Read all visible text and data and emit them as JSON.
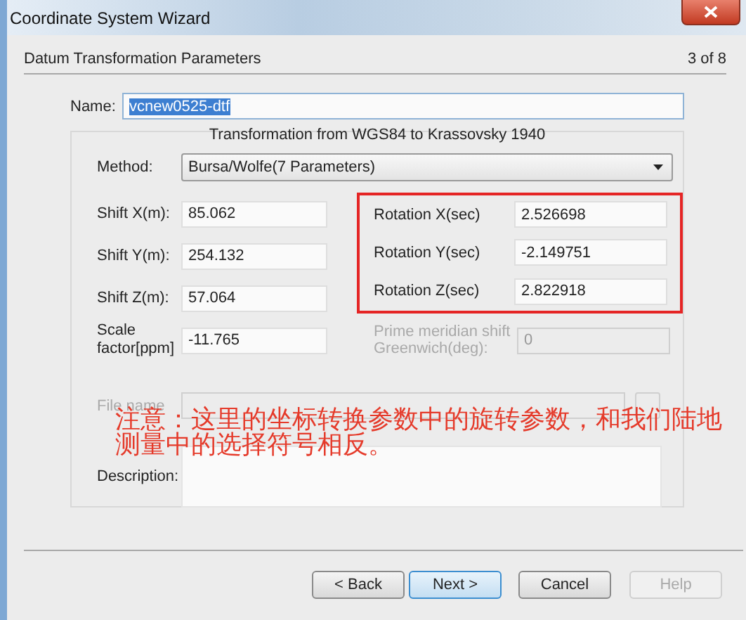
{
  "window": {
    "title": "Coordinate System Wizard"
  },
  "page": {
    "title": "Datum Transformation Parameters",
    "step": "3 of 8"
  },
  "name": {
    "label": "Name:",
    "value": "vcnew0525-dtf",
    "selected": true
  },
  "group": {
    "title": "Transformation from  WGS84 to Krassovsky 1940"
  },
  "method": {
    "label": "Method:",
    "value": "Bursa/Wolfe(7 Parameters)"
  },
  "shifts": [
    {
      "label": "Shift X(m):",
      "value": "85.062"
    },
    {
      "label": "Shift Y(m):",
      "value": "254.132"
    },
    {
      "label": "Shift Z(m):",
      "value": "57.064"
    }
  ],
  "rotations": {
    "highlighted": true,
    "items": [
      {
        "label": "Rotation X(sec)",
        "value": "2.526698"
      },
      {
        "label": "Rotation Y(sec)",
        "value": "-2.149751"
      },
      {
        "label": "Rotation Z(sec)",
        "value": "2.822918"
      }
    ]
  },
  "scale": {
    "label": "Scale factor[ppm]",
    "value": "-11.765"
  },
  "prime_meridian": {
    "label": "Prime meridian shift Greenwich(deg):",
    "value": "0",
    "disabled": true
  },
  "file_name": {
    "label": "File name",
    "disabled": true
  },
  "description": {
    "label": "Description:"
  },
  "annotation": "注意：这里的坐标转换参数中的旋转参数，和我们陆地测量中的选择符号相反。",
  "buttons": [
    {
      "label": "< Back",
      "default": false,
      "disabled": false
    },
    {
      "label": "Next >",
      "default": true,
      "disabled": false
    },
    {
      "label": "Cancel",
      "default": false,
      "disabled": false
    },
    {
      "label": "Help",
      "default": false,
      "disabled": true
    }
  ]
}
